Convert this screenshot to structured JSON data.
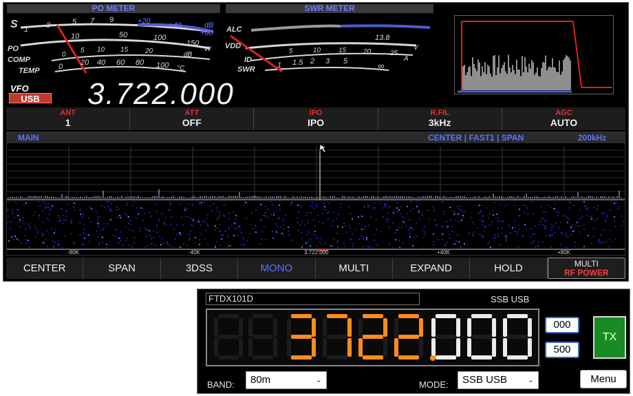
{
  "meters": {
    "po_title": "PO METER",
    "swr_title": "SWR METER",
    "s_scale": [
      "S",
      "1",
      "3",
      "5",
      "7",
      "9",
      "+20",
      "+40",
      "dB",
      "+60"
    ],
    "po_scale": [
      "PO",
      "10",
      "50",
      "100",
      "150",
      "W"
    ],
    "comp_scale": [
      "COMP",
      "0",
      "5",
      "10",
      "15",
      "20",
      "dB"
    ],
    "temp_scale": [
      "TEMP",
      "0",
      "20",
      "40",
      "60",
      "80",
      "100",
      "°C"
    ],
    "alc_scale": [
      "ALC"
    ],
    "vdd_scale": [
      "VDD",
      "13.8"
    ],
    "id_scale": [
      "ID",
      "5",
      "10",
      "15",
      "20",
      "25",
      "A"
    ],
    "swr_scale": [
      "SWR",
      "1",
      "1.5",
      "2",
      "3",
      "5",
      "∞"
    ],
    "v_label": "V"
  },
  "vfo": {
    "label": "VFO",
    "mode": "USB",
    "frequency": "3.722.000"
  },
  "status": [
    {
      "label": "ANT",
      "value": "1"
    },
    {
      "label": "ATT",
      "value": "OFF"
    },
    {
      "label": "IPO",
      "value": "IPO"
    },
    {
      "label": "R.FIL",
      "value": "3kHz"
    },
    {
      "label": "AGC",
      "value": "AUTO"
    }
  ],
  "scope": {
    "title": "MAIN",
    "settings": "CENTER | FAST1 | SPAN",
    "span": "200kHz",
    "ticks": [
      "-80K",
      "-40K",
      "3.722.000",
      "+40K",
      "+80K"
    ]
  },
  "softkeys": [
    "CENTER",
    "SPAN",
    "3DSS",
    "MONO",
    "MULTI",
    "EXPAND",
    "HOLD"
  ],
  "softkey_last": {
    "line1": "MULTI",
    "line2": "RF POWER"
  },
  "panel": {
    "model": "FTDX101D",
    "mode_readout": "SSB USB",
    "freq_digits": [
      "3",
      "7",
      "2",
      "2",
      "0",
      "0",
      "0"
    ],
    "step_top": "000",
    "step_bottom": "500",
    "tx": "TX",
    "menu": "Menu",
    "band_label": "BAND:",
    "band_value": "80m",
    "mode_label": "MODE:",
    "mode_value": "SSB USB"
  },
  "colors": {
    "freq_orange": "#ff8c1a",
    "freq_white": "#ebebeb",
    "scope_blue": "#5a74ff",
    "label_red": "#e03030",
    "tx_green": "#1a8a24"
  }
}
